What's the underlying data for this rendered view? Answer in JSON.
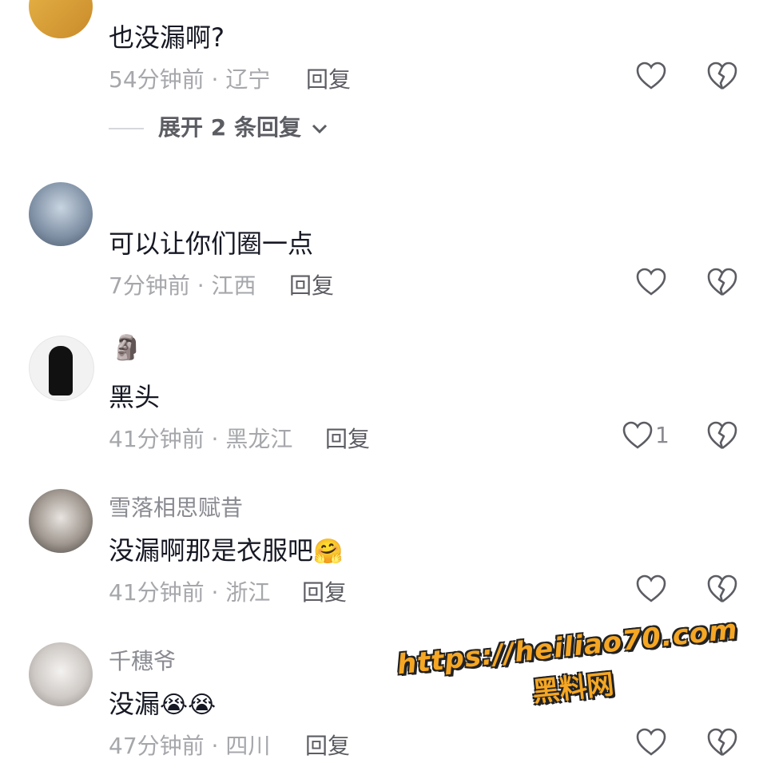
{
  "comments": [
    {
      "content": "也没漏啊?",
      "meta": "54分钟前 · 辽宁",
      "reply": "回复",
      "expand": "展开 2 条回复"
    },
    {
      "content": "可以让你们圈一点",
      "meta": "7分钟前 · 江西",
      "reply": "回复"
    },
    {
      "badge": "🗿",
      "content": "黑头",
      "meta": "41分钟前 · 黑龙江",
      "reply": "回复",
      "likes": "1"
    },
    {
      "username": "雪落相思赋昔",
      "content": "没漏啊那是衣服吧",
      "content_emoji": "🤗",
      "meta": "41分钟前 · 浙江",
      "reply": "回复"
    },
    {
      "username": "千穗爷",
      "content": "没漏",
      "content_emoji": "😭😭",
      "meta": "47分钟前 · 四川",
      "reply": "回复"
    }
  ],
  "watermark": {
    "url": "https://heiliao70.com",
    "name": "黑料网"
  },
  "colors": {
    "text": "#161823",
    "meta": "#a6a7ab",
    "watermark": "#f5a623"
  },
  "icons": [
    "heart-icon",
    "broken-heart-icon",
    "chevron-down-icon"
  ]
}
